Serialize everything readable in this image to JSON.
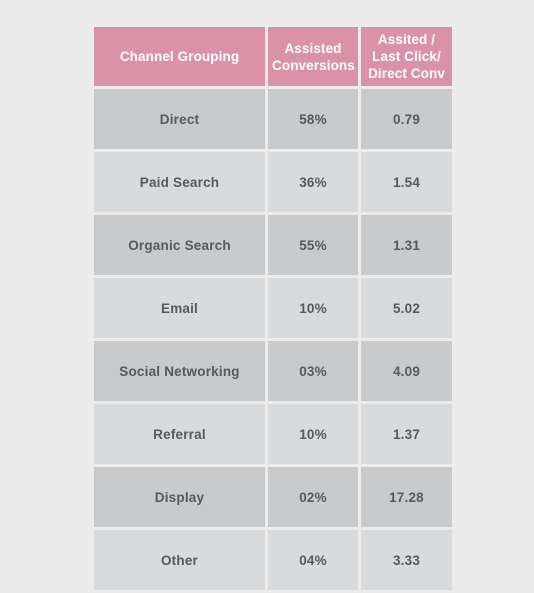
{
  "table": {
    "headers": [
      "Channel Grouping",
      "Assisted Conversions",
      "Assited / Last Click/ Direct Conv"
    ],
    "rows": [
      {
        "channel": "Direct",
        "assisted_conversions": "58%",
        "assisted_last_click_ratio": "0.79"
      },
      {
        "channel": "Paid Search",
        "assisted_conversions": "36%",
        "assisted_last_click_ratio": "1.54"
      },
      {
        "channel": "Organic Search",
        "assisted_conversions": "55%",
        "assisted_last_click_ratio": "1.31"
      },
      {
        "channel": "Email",
        "assisted_conversions": "10%",
        "assisted_last_click_ratio": "5.02"
      },
      {
        "channel": "Social Networking",
        "assisted_conversions": "03%",
        "assisted_last_click_ratio": "4.09"
      },
      {
        "channel": "Referral",
        "assisted_conversions": "10%",
        "assisted_last_click_ratio": "1.37"
      },
      {
        "channel": "Display",
        "assisted_conversions": "02%",
        "assisted_last_click_ratio": "17.28"
      },
      {
        "channel": "Other",
        "assisted_conversions": "04%",
        "assisted_last_click_ratio": "3.33"
      }
    ]
  },
  "colors": {
    "header_background": "#d992a8",
    "header_text": "#ffffff",
    "row_odd_background": "#c8cacc",
    "row_even_background": "#d9dadb",
    "cell_text": "#555a61",
    "page_background": "#ececec"
  },
  "chart_data": {
    "type": "table",
    "title": "",
    "columns": [
      "Channel Grouping",
      "Assisted Conversions",
      "Assited / Last Click/ Direct Conv"
    ],
    "categories": [
      "Direct",
      "Paid Search",
      "Organic Search",
      "Email",
      "Social Networking",
      "Referral",
      "Display",
      "Other"
    ],
    "series": [
      {
        "name": "Assisted Conversions",
        "unit": "%",
        "values": [
          58,
          36,
          55,
          10,
          3,
          2,
          10,
          4
        ],
        "display_values": [
          "58%",
          "36%",
          "55%",
          "10%",
          "03%",
          "10%",
          "02%",
          "04%"
        ]
      },
      {
        "name": "Assited / Last Click/ Direct Conv",
        "unit": "ratio",
        "values": [
          0.79,
          1.54,
          1.31,
          5.02,
          4.09,
          1.37,
          17.28,
          3.33
        ],
        "display_values": [
          "0.79",
          "1.54",
          "1.31",
          "5.02",
          "4.09",
          "1.37",
          "17.28",
          "3.33"
        ]
      }
    ],
    "rows": [
      [
        "Direct",
        "58%",
        "0.79"
      ],
      [
        "Paid Search",
        "36%",
        "1.54"
      ],
      [
        "Organic Search",
        "55%",
        "1.31"
      ],
      [
        "Email",
        "10%",
        "5.02"
      ],
      [
        "Social Networking",
        "03%",
        "4.09"
      ],
      [
        "Referral",
        "10%",
        "1.37"
      ],
      [
        "Display",
        "02%",
        "17.28"
      ],
      [
        "Other",
        "04%",
        "3.33"
      ]
    ]
  }
}
